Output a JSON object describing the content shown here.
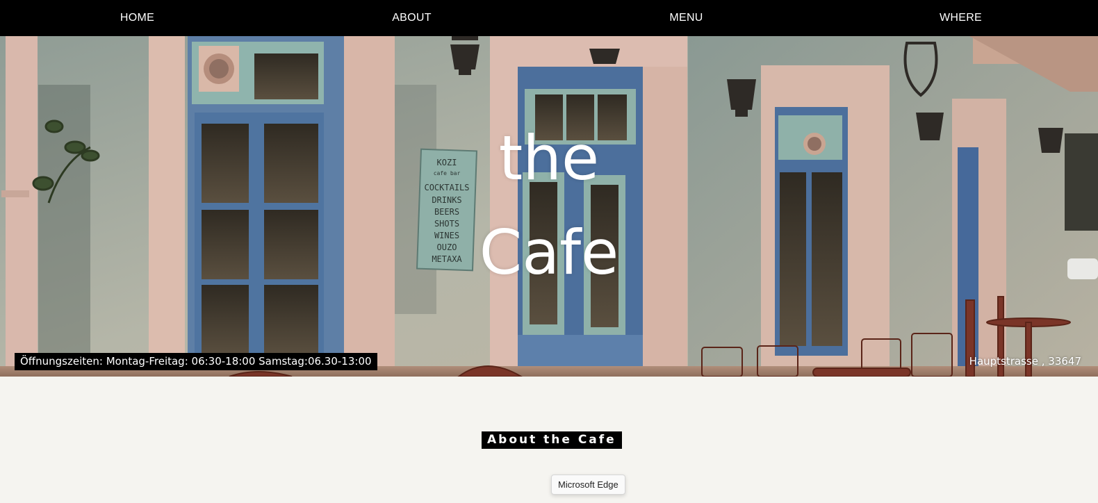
{
  "nav": {
    "items": [
      {
        "label": "HOME"
      },
      {
        "label": "ABOUT"
      },
      {
        "label": "MENU"
      },
      {
        "label": "WHERE"
      }
    ]
  },
  "hero": {
    "title_line1": "the",
    "title_line2": "Cafe",
    "hours": "Öffnungszeiten: Montag-Freitag: 06:30-18:00 Samstag:06.30-13:00",
    "address": "Hauptstrasse , 33647",
    "sign_lines": [
      "KOZI",
      "cafe bar",
      "COCKTAILS",
      "DRINKS",
      "BEERS",
      "SHOTS",
      "WINES",
      "OUZO",
      "METAXA"
    ]
  },
  "about": {
    "heading": "About the Cafe"
  },
  "tooltip": {
    "text": "Microsoft Edge"
  },
  "colors": {
    "nav_bg": "#000000",
    "page_bg": "#f5f4f0",
    "label_bg": "#000000",
    "text_light": "#ffffff"
  }
}
